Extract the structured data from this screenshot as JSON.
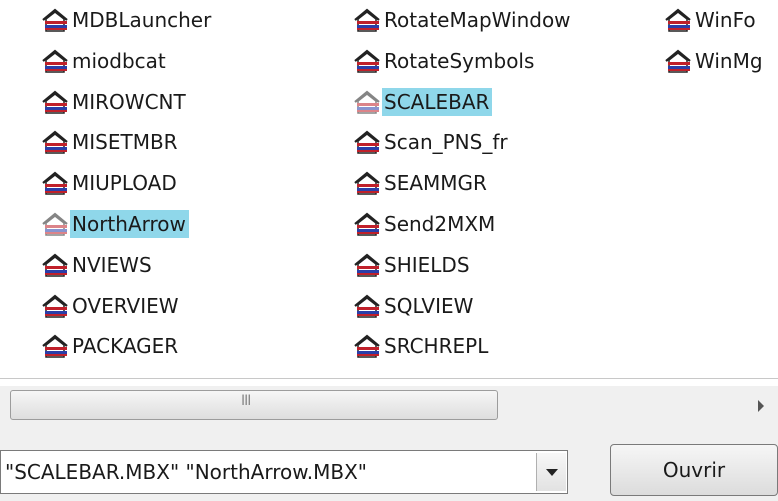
{
  "columns": [
    [
      {
        "label": "MDBLauncher",
        "selected": false
      },
      {
        "label": "miodbcat",
        "selected": false
      },
      {
        "label": "MIROWCNT",
        "selected": false
      },
      {
        "label": "MISETMBR",
        "selected": false
      },
      {
        "label": "MIUPLOAD",
        "selected": false
      },
      {
        "label": "NorthArrow",
        "selected": true
      },
      {
        "label": "NVIEWS",
        "selected": false
      },
      {
        "label": "OVERVIEW",
        "selected": false
      },
      {
        "label": "PACKAGER",
        "selected": false
      }
    ],
    [
      {
        "label": "RotateMapWindow",
        "selected": false
      },
      {
        "label": "RotateSymbols",
        "selected": false
      },
      {
        "label": "SCALEBAR",
        "selected": true
      },
      {
        "label": "Scan_PNS_fr",
        "selected": false
      },
      {
        "label": "SEAMMGR",
        "selected": false
      },
      {
        "label": "Send2MXM",
        "selected": false
      },
      {
        "label": "SHIELDS",
        "selected": false
      },
      {
        "label": "SQLVIEW",
        "selected": false
      },
      {
        "label": "SRCHREPL",
        "selected": false
      }
    ],
    [
      {
        "label": "WinFo",
        "selected": false
      },
      {
        "label": "WinMg",
        "selected": false
      }
    ]
  ],
  "scrollbar": {
    "grip": "III"
  },
  "filename": {
    "value": "\"SCALEBAR.MBX\" \"NorthArrow.MBX\""
  },
  "open_button": {
    "label": "Ouvrir"
  },
  "colors": {
    "selection": "#8fd7ea",
    "icon_red": "#c0202a",
    "icon_blue": "#2a3ea8"
  },
  "icon_name": "mapbasic-program-icon"
}
